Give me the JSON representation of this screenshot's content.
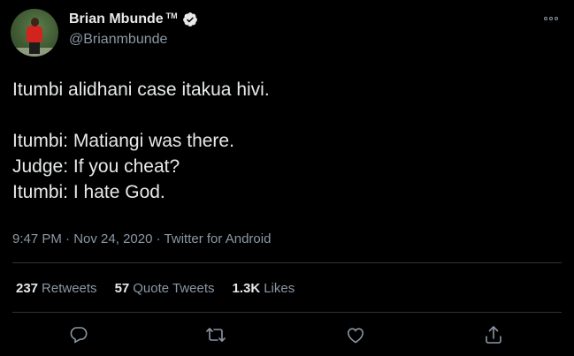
{
  "author": {
    "display_name": "Brian Mbunde",
    "trademark": "TM",
    "handle": "@Brianmbunde"
  },
  "tweet": {
    "lines": [
      "Itumbi alidhani case itakua hivi.",
      "",
      "Itumbi: Matiangi was there.",
      "Judge: If you cheat?",
      "Itumbi: I hate God."
    ],
    "time": "9:47 PM",
    "date": "Nov 24, 2020",
    "source": "Twitter for Android",
    "separator": "·"
  },
  "stats": {
    "retweets_count": "237",
    "retweets_label": "Retweets",
    "quotes_count": "57",
    "quotes_label": "Quote Tweets",
    "likes_count": "1.3K",
    "likes_label": "Likes"
  },
  "colors": {
    "background": "#000000",
    "text_primary": "#e7e9ea",
    "text_secondary": "#8b98a5",
    "divider": "#2f3336",
    "verified_badge": "#e7e9ea"
  },
  "icons": {
    "verified": "verified-badge-icon",
    "more": "more-options-icon",
    "reply": "reply-icon",
    "retweet": "retweet-icon",
    "like": "heart-icon",
    "share": "share-icon"
  }
}
